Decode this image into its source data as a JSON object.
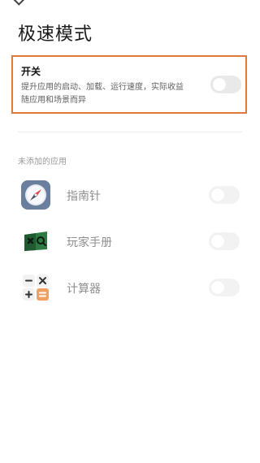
{
  "header": {
    "title": "极速模式"
  },
  "master_switch": {
    "title": "开关",
    "description": "提升应用的启动、加载、运行速度，实际收益随应用和场景而异",
    "enabled": false
  },
  "section": {
    "label": "未添加的应用"
  },
  "apps": [
    {
      "name": "指南针",
      "icon": "compass-icon",
      "enabled": false
    },
    {
      "name": "玩家手册",
      "icon": "game-handbook-icon",
      "enabled": false
    },
    {
      "name": "计算器",
      "icon": "calculator-icon",
      "enabled": false
    }
  ],
  "colors": {
    "highlight_border": "#e07a3c",
    "toggle_off": "#ececec",
    "calculator_accent": "#f0a060",
    "handbook_green": "#3c8b4f"
  }
}
